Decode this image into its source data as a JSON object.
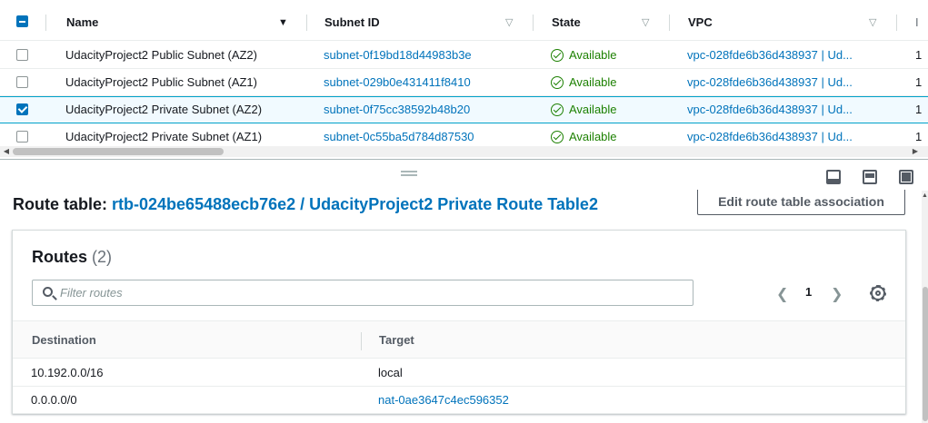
{
  "subnets": {
    "columns": {
      "name": "Name",
      "subnet_id": "Subnet ID",
      "state": "State",
      "vpc": "VPC",
      "next": "I"
    },
    "rows": [
      {
        "name": "UdacityProject2 Public Subnet (AZ2)",
        "subnet_id": "subnet-0f19bd18d44983b3e",
        "state": "Available",
        "vpc": "vpc-028fde6b36d438937 | Ud...",
        "next": "1",
        "selected": false
      },
      {
        "name": "UdacityProject2 Public Subnet (AZ1)",
        "subnet_id": "subnet-029b0e431411f8410",
        "state": "Available",
        "vpc": "vpc-028fde6b36d438937 | Ud...",
        "next": "1",
        "selected": false
      },
      {
        "name": "UdacityProject2 Private Subnet (AZ2)",
        "subnet_id": "subnet-0f75cc38592b48b20",
        "state": "Available",
        "vpc": "vpc-028fde6b36d438937 | Ud...",
        "next": "1",
        "selected": true
      },
      {
        "name": "UdacityProject2 Private Subnet (AZ1)",
        "subnet_id": "subnet-0c55ba5d784d87530",
        "state": "Available",
        "vpc": "vpc-028fde6b36d438937 | Ud...",
        "next": "1",
        "selected": false
      }
    ]
  },
  "details": {
    "route_table_label": "Route table:",
    "route_table_link": "rtb-024be65488ecb76e2 / UdacityProject2 Private Route Table2",
    "edit_button": "Edit route table association",
    "routes_title": "Routes",
    "routes_count": "(2)",
    "filter_placeholder": "Filter routes",
    "page_number": "1",
    "table": {
      "columns": {
        "destination": "Destination",
        "target": "Target"
      },
      "rows": [
        {
          "destination": "10.192.0.0/16",
          "target": "local",
          "target_is_link": false
        },
        {
          "destination": "0.0.0.0/0",
          "target": "nat-0ae3647c4ec596352",
          "target_is_link": true
        }
      ]
    }
  },
  "icons": {
    "pager_prev": "chevron-left-icon",
    "pager_next": "chevron-right-icon",
    "settings": "gear-icon",
    "search": "search-icon",
    "state": "check-circle-icon"
  },
  "colors": {
    "link": "#0073bb",
    "success": "#1d8102",
    "selected_row": "#f1faff",
    "selected_border": "#00a1c9"
  }
}
